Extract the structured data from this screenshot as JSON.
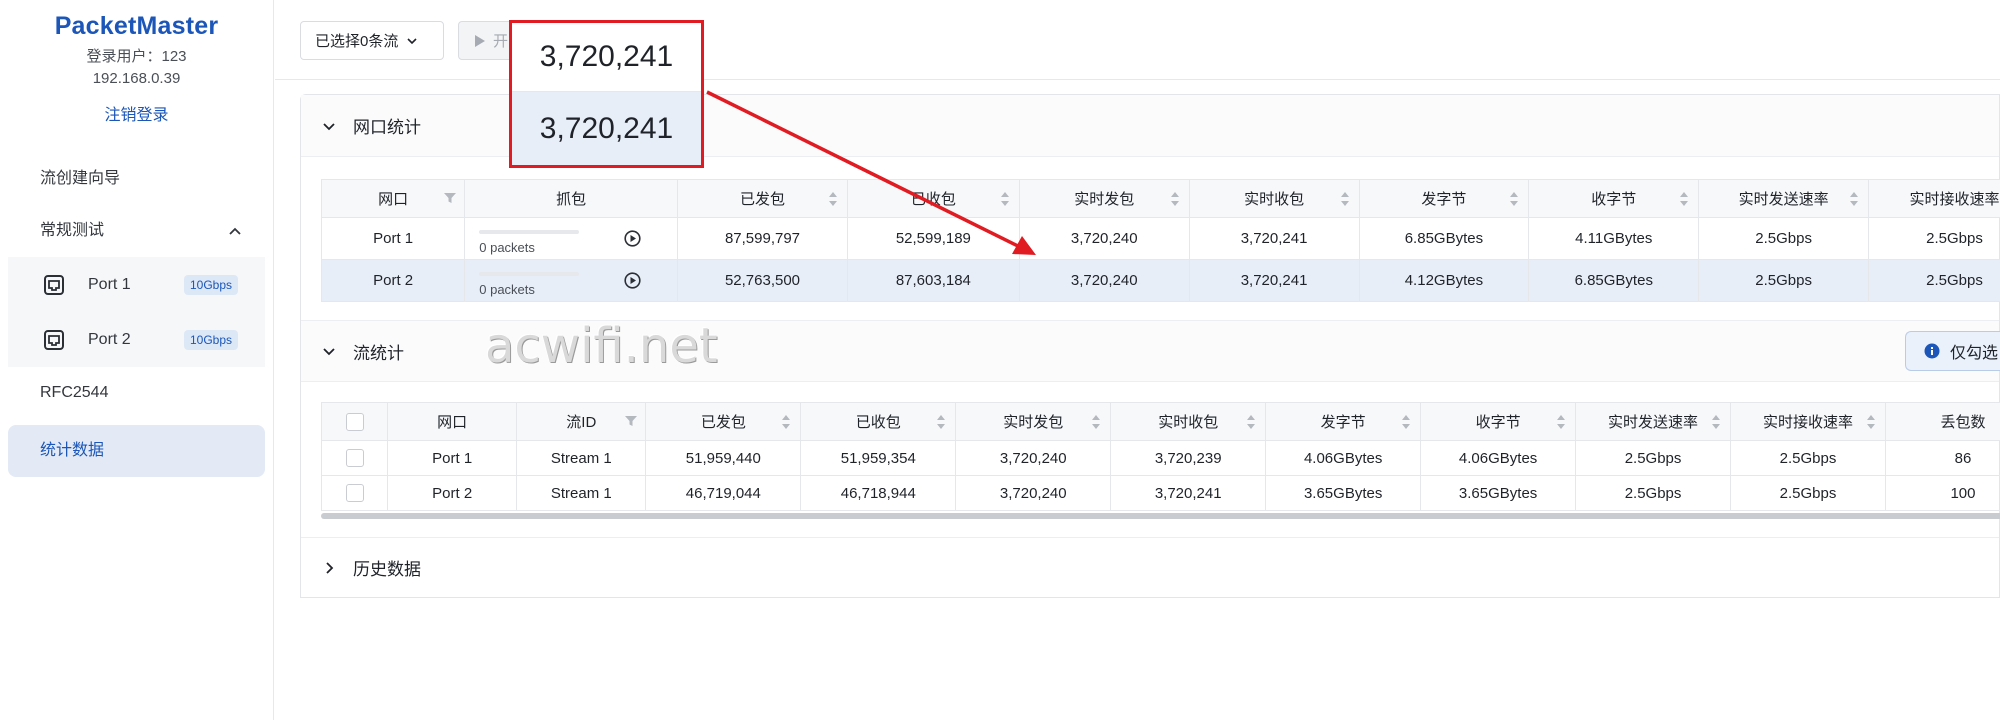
{
  "brand": "PacketMaster",
  "user": {
    "login_line": "登录用户：123",
    "ip": "192.168.0.39",
    "logout": "注销登录"
  },
  "nav": {
    "wizard": "流创建向导",
    "regular_test": "常规测试",
    "ports": [
      {
        "label": "Port 1",
        "speed": "10Gbps"
      },
      {
        "label": "Port 2",
        "speed": "10Gbps"
      }
    ],
    "rfc": "RFC2544",
    "stats": "统计数据"
  },
  "toolbar": {
    "select_label": "已选择0条流",
    "start_label": "开"
  },
  "port_stats": {
    "title": "网口统计",
    "headers": [
      "网口",
      "抓包",
      "已发包",
      "已收包",
      "实时发包",
      "实时收包",
      "发字节",
      "收字节",
      "实时发送速率",
      "实时接收速率"
    ],
    "rows": [
      {
        "port": "Port 1",
        "capture": "0 packets",
        "tx": "87,599,797",
        "rx": "52,599,189",
        "rt_tx": "3,720,240",
        "rt_rx": "3,720,241",
        "tx_bytes": "6.85GBytes",
        "rx_bytes": "4.11GBytes",
        "tx_rate": "2.5Gbps",
        "rx_rate": "2.5Gbps"
      },
      {
        "port": "Port 2",
        "capture": "0 packets",
        "tx": "52,763,500",
        "rx": "87,603,184",
        "rt_tx": "3,720,240",
        "rt_rx": "3,720,241",
        "tx_bytes": "4.12GBytes",
        "rx_bytes": "6.85GBytes",
        "tx_rate": "2.5Gbps",
        "rx_rate": "2.5Gbps"
      }
    ]
  },
  "stream_stats": {
    "title": "流统计",
    "only_selected": "仅勾选",
    "headers": [
      "网口",
      "流ID",
      "已发包",
      "已收包",
      "实时发包",
      "实时收包",
      "发字节",
      "收字节",
      "实时发送速率",
      "实时接收速率",
      "丢包数"
    ],
    "rows": [
      {
        "port": "Port 1",
        "stream": "Stream 1",
        "tx": "51,959,440",
        "rx": "51,959,354",
        "rt_tx": "3,720,240",
        "rt_rx": "3,720,239",
        "tx_bytes": "4.06GBytes",
        "rx_bytes": "4.06GBytes",
        "tx_rate": "2.5Gbps",
        "rx_rate": "2.5Gbps",
        "lost": "86"
      },
      {
        "port": "Port 2",
        "stream": "Stream 1",
        "tx": "46,719,044",
        "rx": "46,718,944",
        "rt_tx": "3,720,240",
        "rt_rx": "3,720,241",
        "tx_bytes": "3.65GBytes",
        "rx_bytes": "3.65GBytes",
        "tx_rate": "2.5Gbps",
        "rx_rate": "2.5Gbps",
        "lost": "100"
      }
    ]
  },
  "history": {
    "title": "历史数据"
  },
  "zoom": {
    "top": "3,720,241",
    "bottom": "3,720,241"
  },
  "watermark": "acwifi.net",
  "colors": {
    "accent": "#1b56b8",
    "highlight": "#e8eef8",
    "annotation": "#e11b22"
  }
}
